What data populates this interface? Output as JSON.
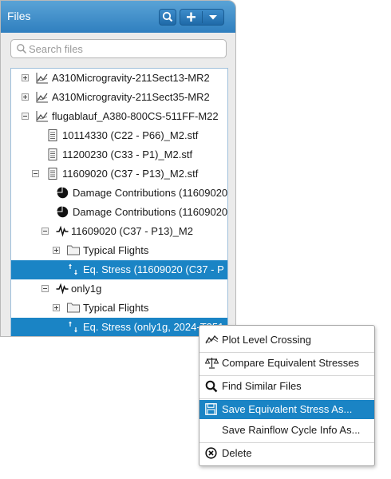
{
  "panel": {
    "title": "Files",
    "search_placeholder": "Search files"
  },
  "tree": [
    {
      "label": "A310Microgravity-211Sect13-MR2",
      "icon": "chart-line-icon",
      "expander": "plus"
    },
    {
      "label": "A310Microgravity-211Sect35-MR2",
      "icon": "chart-line-icon",
      "expander": "plus"
    },
    {
      "label": "flugablauf_A380-800CS-511FF-M22",
      "icon": "chart-line-icon",
      "expander": "minus"
    },
    {
      "label": "10114330 (C22 - P66)_M2.stf",
      "icon": "document-icon"
    },
    {
      "label": "11200230 (C33 - P1)_M2.stf",
      "icon": "document-icon"
    },
    {
      "label": "11609020 (C37 - P13)_M2.stf",
      "icon": "document-icon",
      "expander": "minus"
    },
    {
      "label": "Damage Contributions (11609020",
      "icon": "pie-chart-icon"
    },
    {
      "label": "Damage Contributions (11609020",
      "icon": "pie-chart-icon"
    },
    {
      "label": "11609020 (C37 - P13)_M2",
      "icon": "signal-icon",
      "expander": "minus"
    },
    {
      "label": "Typical Flights",
      "icon": "folder-icon",
      "expander": "plus"
    },
    {
      "label": "Eq. Stress (11609020 (C37 - P",
      "icon": "stress-icon",
      "selected": true
    },
    {
      "label": "only1g",
      "icon": "signal-icon",
      "expander": "minus"
    },
    {
      "label": "Typical Flights",
      "icon": "folder-icon",
      "expander": "plus"
    },
    {
      "label": "Eq. Stress (only1g, 2024-T351",
      "icon": "stress-icon",
      "selected": true
    }
  ],
  "context_menu": {
    "items": [
      {
        "label": "Plot Level Crossing",
        "icon": "level-crossing-icon"
      },
      {
        "label": "Compare Equivalent Stresses",
        "icon": "balance-icon"
      },
      {
        "label": "Find Similar Files",
        "icon": "search-icon"
      },
      {
        "label": "Save Equivalent Stress As...",
        "icon": "save-icon",
        "active": true
      },
      {
        "label": "Save Rainflow Cycle Info As...",
        "icon": ""
      },
      {
        "label": "Delete",
        "icon": "delete-icon"
      }
    ]
  },
  "colors": {
    "header": "#3a8ccd",
    "selection": "#1a84c5",
    "panel_bg": "#ebebeb"
  }
}
